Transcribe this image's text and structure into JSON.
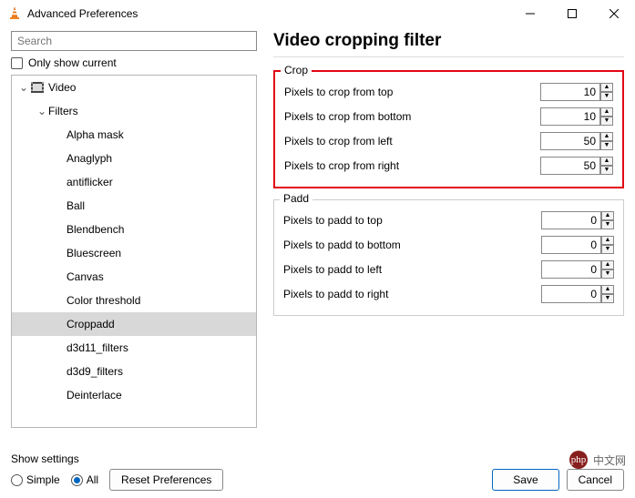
{
  "window": {
    "title": "Advanced Preferences"
  },
  "search": {
    "placeholder": "Search"
  },
  "only_current_label": "Only show current",
  "tree": {
    "video_label": "Video",
    "filters_label": "Filters",
    "items": [
      {
        "label": "Alpha mask"
      },
      {
        "label": "Anaglyph"
      },
      {
        "label": "antiflicker"
      },
      {
        "label": "Ball"
      },
      {
        "label": "Blendbench"
      },
      {
        "label": "Bluescreen"
      },
      {
        "label": "Canvas"
      },
      {
        "label": "Color threshold"
      },
      {
        "label": "Croppadd"
      },
      {
        "label": "d3d11_filters"
      },
      {
        "label": "d3d9_filters"
      },
      {
        "label": "Deinterlace"
      }
    ],
    "selected_index": 8
  },
  "page": {
    "title": "Video cropping filter",
    "crop": {
      "legend": "Crop",
      "rows": [
        {
          "label": "Pixels to crop from top",
          "value": "10"
        },
        {
          "label": "Pixels to crop from bottom",
          "value": "10"
        },
        {
          "label": "Pixels to crop from left",
          "value": "50"
        },
        {
          "label": "Pixels to crop from right",
          "value": "50"
        }
      ]
    },
    "padd": {
      "legend": "Padd",
      "rows": [
        {
          "label": "Pixels to padd to top",
          "value": "0"
        },
        {
          "label": "Pixels to padd to bottom",
          "value": "0"
        },
        {
          "label": "Pixels to padd to left",
          "value": "0"
        },
        {
          "label": "Pixels to padd to right",
          "value": "0"
        }
      ]
    }
  },
  "footer": {
    "show_settings_label": "Show settings",
    "radio_simple": "Simple",
    "radio_all": "All",
    "reset_label": "Reset Preferences",
    "save_label": "Save",
    "cancel_label": "Cancel"
  },
  "watermark": {
    "text": "中文网"
  }
}
